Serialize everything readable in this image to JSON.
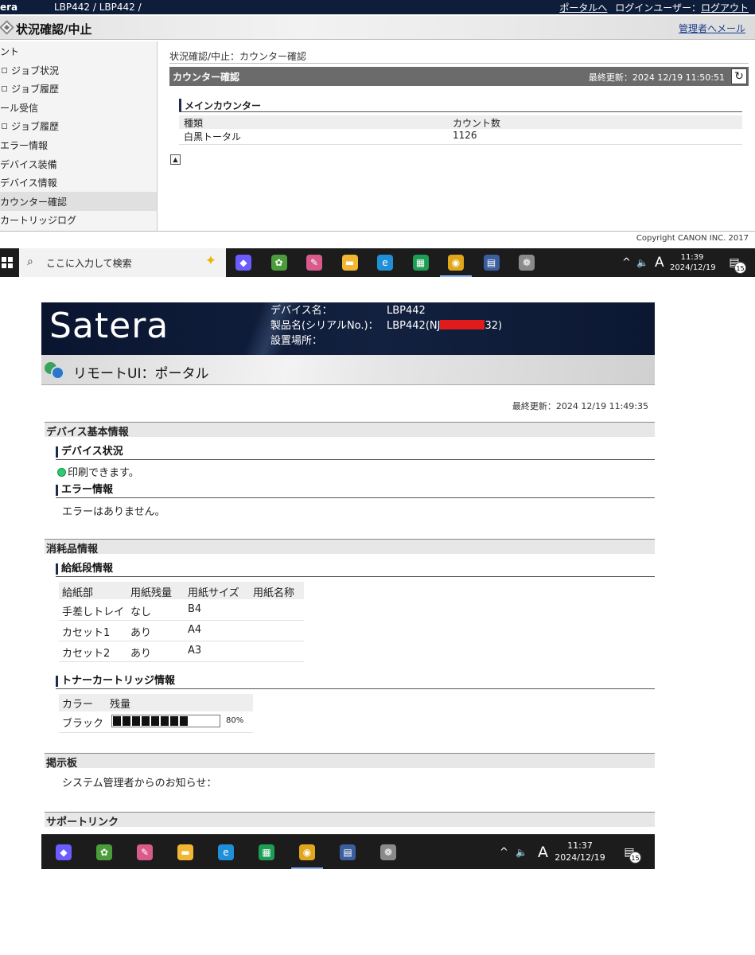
{
  "top": {
    "header": {
      "brand": "era",
      "device_path": "LBP442 / LBP442 /",
      "portal_link": "ポータルへ",
      "login_user_label": "ログインユーザー：",
      "logout_link": "ログアウト"
    },
    "title": "状況確認/中止",
    "admin_mail": "管理者へメール",
    "sidebar": [
      {
        "label": "ント",
        "type": "head"
      },
      {
        "label": "ジョブ状況",
        "type": "sub"
      },
      {
        "label": "ジョブ履歴",
        "type": "sub"
      },
      {
        "label": "ール受信",
        "type": "head"
      },
      {
        "label": "ジョブ履歴",
        "type": "sub"
      },
      {
        "label": "エラー情報",
        "type": "head"
      },
      {
        "label": "デバイス装備",
        "type": "head"
      },
      {
        "label": "デバイス情報",
        "type": "head"
      },
      {
        "label": "カウンター確認",
        "type": "selected"
      },
      {
        "label": "カートリッジログ",
        "type": "head"
      }
    ],
    "breadcrumb": "状況確認/中止：カウンター確認",
    "panel_title": "カウンター確認",
    "last_update": "最終更新：2024 12/19 11:50:51",
    "refresh_icon": "↻",
    "section_title": "メインカウンター",
    "table": {
      "headers": [
        "種類",
        "カウント数"
      ],
      "rows": [
        [
          "白黒トータル",
          "1126"
        ]
      ]
    },
    "top_icon": "▲",
    "copyright": "Copyright CANON INC. 2017",
    "taskbar": {
      "search_placeholder": "ここに入力して検索",
      "tray_arrow": "^",
      "tray_volume": "🔈",
      "tray_ime": "A",
      "time": "11:39",
      "date": "2024/12/19",
      "notif_count": "15"
    }
  },
  "bottom": {
    "logo": "Satera",
    "device": {
      "name_label": "デバイス名：",
      "name_value": "LBP442",
      "product_label": "製品名(シリアルNo.)：",
      "product_prefix": "LBP442(NJ",
      "product_suffix": "32)",
      "location_label": "設置場所："
    },
    "title": "リモートUI：ポータル",
    "last_update": "最終更新：2024 12/19 11:49:35",
    "sections": {
      "basic": "デバイス基本情報",
      "supplies": "消耗品情報",
      "board": "掲示板",
      "support": "サポートリンク"
    },
    "device_status_title": "デバイス状況",
    "device_status_text": "印刷できます。",
    "error_title": "エラー情報",
    "error_text": "エラーはありません。",
    "paper_title": "給紙段情報",
    "paper_table": {
      "headers": [
        "給紙部",
        "用紙残量",
        "用紙サイズ",
        "用紙名称"
      ],
      "rows": [
        [
          "手差しトレイ",
          "なし",
          "B4",
          ""
        ],
        [
          "カセット1",
          "あり",
          "A4",
          ""
        ],
        [
          "カセット2",
          "あり",
          "A3",
          ""
        ]
      ]
    },
    "toner_title": "トナーカートリッジ情報",
    "toner_table": {
      "headers": [
        "カラー",
        "残量"
      ],
      "rows": [
        {
          "color": "ブラック",
          "level_percent": 80,
          "level_text": "80%"
        }
      ]
    },
    "board_text": "システム管理者からのお知らせ：",
    "taskbar": {
      "tray_arrow": "^",
      "tray_volume": "🔈",
      "tray_ime": "A",
      "time": "11:37",
      "date": "2024/12/19",
      "notif_count": "15"
    }
  },
  "taskbar_icons": [
    {
      "name": "copilot-icon",
      "glyph": "◆",
      "color": "#6a5cff"
    },
    {
      "name": "app-icon",
      "glyph": "✿",
      "color": "#4a9d3a"
    },
    {
      "name": "paint-icon",
      "glyph": "✎",
      "color": "#d95b8c"
    },
    {
      "name": "file-explorer-icon",
      "glyph": "▬",
      "color": "#f2b632"
    },
    {
      "name": "edge-icon",
      "glyph": "e",
      "color": "#1f8fd8"
    },
    {
      "name": "sheets-icon",
      "glyph": "▦",
      "color": "#1e9e55"
    },
    {
      "name": "chrome-icon",
      "glyph": "◉",
      "color": "#e0a71a"
    },
    {
      "name": "calculator-icon",
      "glyph": "▤",
      "color": "#3b5f9e"
    },
    {
      "name": "palette-icon",
      "glyph": "❁",
      "color": "#8a8a8a"
    }
  ]
}
